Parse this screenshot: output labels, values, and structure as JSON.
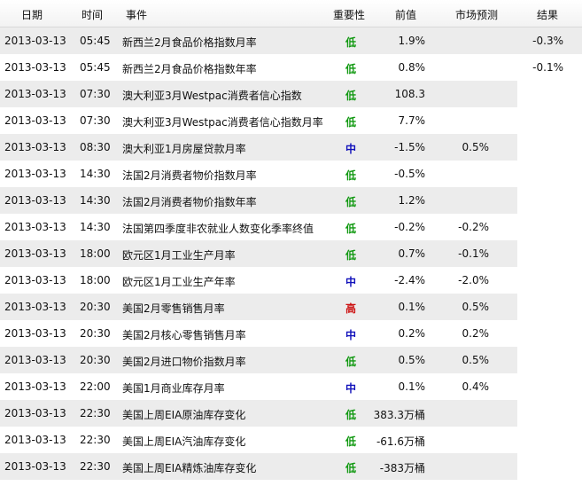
{
  "table": {
    "headers": {
      "date": "日期",
      "time": "时间",
      "event": "事件",
      "importance": "重要性",
      "previous": "前值",
      "forecast": "市场预测",
      "result": "结果"
    },
    "rows": [
      {
        "date": "2013-03-13",
        "time": "05:45",
        "event": "新西兰2月食品价格指数月率",
        "importance": "低",
        "previous": "1.9%",
        "forecast": "",
        "result": "-0.3%"
      },
      {
        "date": "2013-03-13",
        "time": "05:45",
        "event": "新西兰2月食品价格指数年率",
        "importance": "低",
        "previous": "0.8%",
        "forecast": "",
        "result": "-0.1%"
      },
      {
        "date": "2013-03-13",
        "time": "07:30",
        "event": "澳大利亚3月Westpac消费者信心指数",
        "importance": "低",
        "previous": "108.3",
        "forecast": "",
        "result": ""
      },
      {
        "date": "2013-03-13",
        "time": "07:30",
        "event": "澳大利亚3月Westpac消费者信心指数月率",
        "importance": "低",
        "previous": "7.7%",
        "forecast": "",
        "result": ""
      },
      {
        "date": "2013-03-13",
        "time": "08:30",
        "event": "澳大利亚1月房屋贷款月率",
        "importance": "中",
        "previous": "-1.5%",
        "forecast": "0.5%",
        "result": ""
      },
      {
        "date": "2013-03-13",
        "time": "14:30",
        "event": "法国2月消费者物价指数月率",
        "importance": "低",
        "previous": "-0.5%",
        "forecast": "",
        "result": ""
      },
      {
        "date": "2013-03-13",
        "time": "14:30",
        "event": "法国2月消费者物价指数年率",
        "importance": "低",
        "previous": "1.2%",
        "forecast": "",
        "result": ""
      },
      {
        "date": "2013-03-13",
        "time": "14:30",
        "event": "法国第四季度非农就业人数变化季率终值",
        "importance": "低",
        "previous": "-0.2%",
        "forecast": "-0.2%",
        "result": ""
      },
      {
        "date": "2013-03-13",
        "time": "18:00",
        "event": "欧元区1月工业生产月率",
        "importance": "低",
        "previous": "0.7%",
        "forecast": "-0.1%",
        "result": ""
      },
      {
        "date": "2013-03-13",
        "time": "18:00",
        "event": "欧元区1月工业生产年率",
        "importance": "中",
        "previous": "-2.4%",
        "forecast": "-2.0%",
        "result": ""
      },
      {
        "date": "2013-03-13",
        "time": "20:30",
        "event": "美国2月零售销售月率",
        "importance": "高",
        "previous": "0.1%",
        "forecast": "0.5%",
        "result": ""
      },
      {
        "date": "2013-03-13",
        "time": "20:30",
        "event": "美国2月核心零售销售月率",
        "importance": "中",
        "previous": "0.2%",
        "forecast": "0.2%",
        "result": ""
      },
      {
        "date": "2013-03-13",
        "time": "20:30",
        "event": "美国2月进口物价指数月率",
        "importance": "低",
        "previous": "0.5%",
        "forecast": "0.5%",
        "result": ""
      },
      {
        "date": "2013-03-13",
        "time": "22:00",
        "event": "美国1月商业库存月率",
        "importance": "中",
        "previous": "0.1%",
        "forecast": "0.4%",
        "result": ""
      },
      {
        "date": "2013-03-13",
        "time": "22:30",
        "event": "美国上周EIA原油库存变化",
        "importance": "低",
        "previous": "383.3万桶",
        "forecast": "",
        "result": ""
      },
      {
        "date": "2013-03-13",
        "time": "22:30",
        "event": "美国上周EIA汽油库存变化",
        "importance": "低",
        "previous": "-61.6万桶",
        "forecast": "",
        "result": ""
      },
      {
        "date": "2013-03-13",
        "time": "22:30",
        "event": "美国上周EIA精炼油库存变化",
        "importance": "低",
        "previous": "-383万桶",
        "forecast": "",
        "result": ""
      }
    ]
  },
  "colors": {
    "low": "#119911",
    "mid": "#1111bb",
    "high": "#cc1111",
    "row_shade": "#ececec"
  }
}
